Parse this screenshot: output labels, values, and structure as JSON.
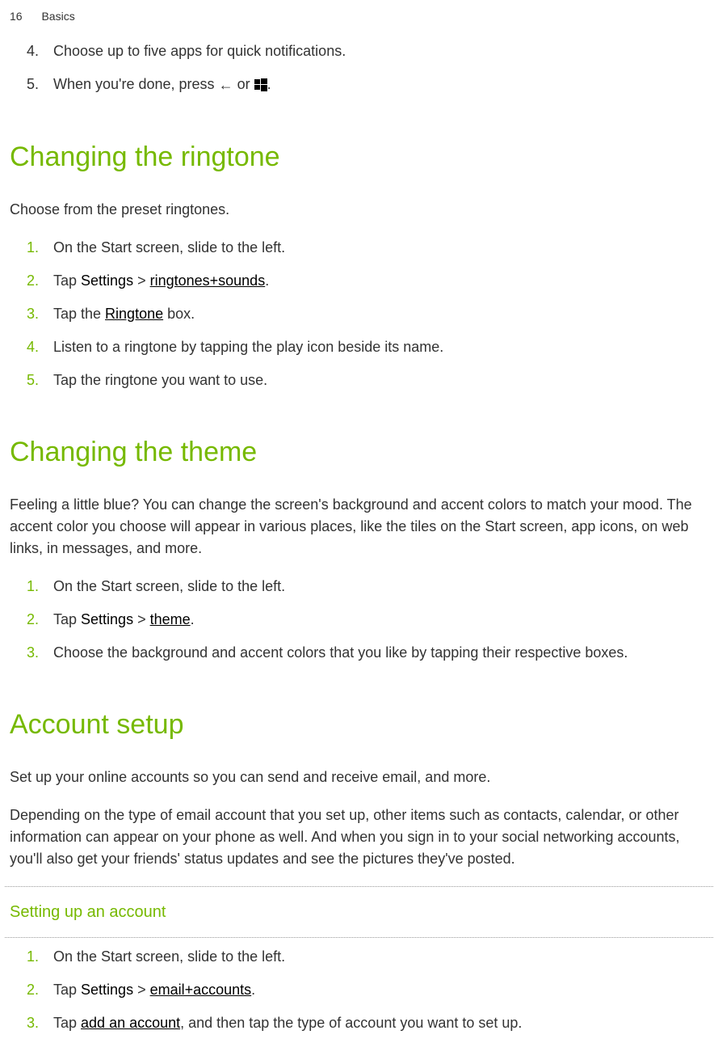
{
  "header": {
    "page_number": "16",
    "section_name": "Basics"
  },
  "top_list": {
    "items": [
      {
        "num": "4.",
        "text": "Choose up to five apps for quick notifications."
      },
      {
        "num": "5.",
        "text_prefix": "When you're done, press ",
        "text_mid": " or ",
        "text_suffix": "."
      }
    ]
  },
  "ringtone_section": {
    "heading": "Changing the ringtone",
    "intro": "Choose from the preset ringtones.",
    "items": [
      {
        "num": "1.",
        "text": "On the Start screen, slide to the left."
      },
      {
        "num": "2.",
        "prefix": "Tap ",
        "bold1": "Settings",
        "mid": " > ",
        "bold2": "ringtones+sounds",
        "suffix": "."
      },
      {
        "num": "3.",
        "prefix": "Tap the ",
        "bold1": "Ringtone",
        "suffix": " box."
      },
      {
        "num": "4.",
        "text": "Listen to a ringtone by tapping the play icon beside its name."
      },
      {
        "num": "5.",
        "text": "Tap the ringtone you want to use."
      }
    ]
  },
  "theme_section": {
    "heading": "Changing the theme",
    "intro": "Feeling a little blue? You can change the screen's background and accent colors to match your mood. The accent color you choose will appear in various places, like the tiles on the Start screen, app icons, on web links, in messages, and more.",
    "items": [
      {
        "num": "1.",
        "text": "On the Start screen, slide to the left."
      },
      {
        "num": "2.",
        "prefix": "Tap ",
        "bold1": "Settings",
        "mid": " > ",
        "bold2": "theme",
        "suffix": "."
      },
      {
        "num": "3.",
        "text": "Choose the background and accent colors that you like by tapping their respective boxes."
      }
    ]
  },
  "account_section": {
    "heading": "Account setup",
    "para1": "Set up your online accounts so you can send and receive email, and more.",
    "para2": "Depending on the type of email account that you set up, other items such as contacts, calendar, or other information can appear on your phone as well. And when you sign in to your social networking accounts, you'll also get your friends' status updates and see the pictures they've posted.",
    "subheading": "Setting up an account",
    "items": [
      {
        "num": "1.",
        "text": "On the Start screen, slide to the left."
      },
      {
        "num": "2.",
        "prefix": "Tap ",
        "bold1": "Settings",
        "mid": " > ",
        "bold2": "email+accounts",
        "suffix": "."
      },
      {
        "num": "3.",
        "prefix": "Tap ",
        "bold1": "add an account",
        "suffix": ", and then tap the type of account you want to set up."
      }
    ]
  }
}
